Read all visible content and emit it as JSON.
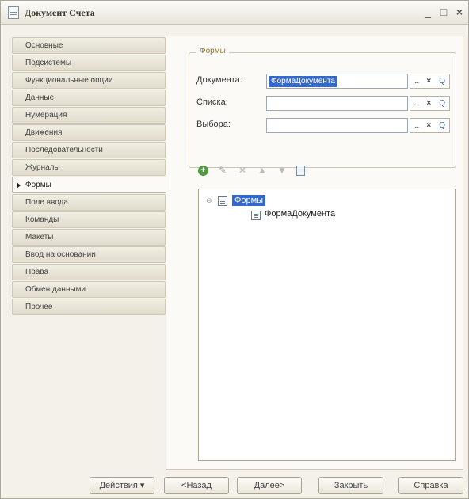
{
  "window": {
    "title": "Документ Счета",
    "controls": {
      "minimize": "_",
      "maximize": "□",
      "close": "×"
    }
  },
  "nav": {
    "items": [
      {
        "label": "Основные",
        "active": false
      },
      {
        "label": "Подсистемы",
        "active": false
      },
      {
        "label": "Функциональные опции",
        "active": false
      },
      {
        "label": "Данные",
        "active": false
      },
      {
        "label": "Нумерация",
        "active": false
      },
      {
        "label": "Движения",
        "active": false
      },
      {
        "label": "Последовательности",
        "active": false
      },
      {
        "label": "Журналы",
        "active": false
      },
      {
        "label": "Формы",
        "active": true
      },
      {
        "label": "Поле ввода",
        "active": false
      },
      {
        "label": "Команды",
        "active": false
      },
      {
        "label": "Макеты",
        "active": false
      },
      {
        "label": "Ввод на основании",
        "active": false
      },
      {
        "label": "Права",
        "active": false
      },
      {
        "label": "Обмен данными",
        "active": false
      },
      {
        "label": "Прочее",
        "active": false
      }
    ]
  },
  "forms_group": {
    "legend": "Формы",
    "fields": [
      {
        "label": "Документа:",
        "value": "ФормаДокумента"
      },
      {
        "label": "Списка:",
        "value": ""
      },
      {
        "label": "Выбора:",
        "value": ""
      }
    ],
    "field_buttons": {
      "select": "...",
      "clear": "×",
      "open": "Q"
    }
  },
  "toolbar": {
    "icons": [
      "add-icon",
      "edit-icon",
      "delete-icon",
      "move-up-icon",
      "move-down-icon",
      "properties-icon"
    ]
  },
  "tree": {
    "root": "Формы",
    "children": [
      "ФормаДокумента"
    ]
  },
  "footer": {
    "actions": "Действия ▾",
    "back": "<Назад",
    "next": "Далее>",
    "close": "Закрыть",
    "help": "Справка"
  },
  "colors": {
    "selection": "#3568c8",
    "background": "#f3f1ea",
    "legend": "#8a7a3a"
  }
}
